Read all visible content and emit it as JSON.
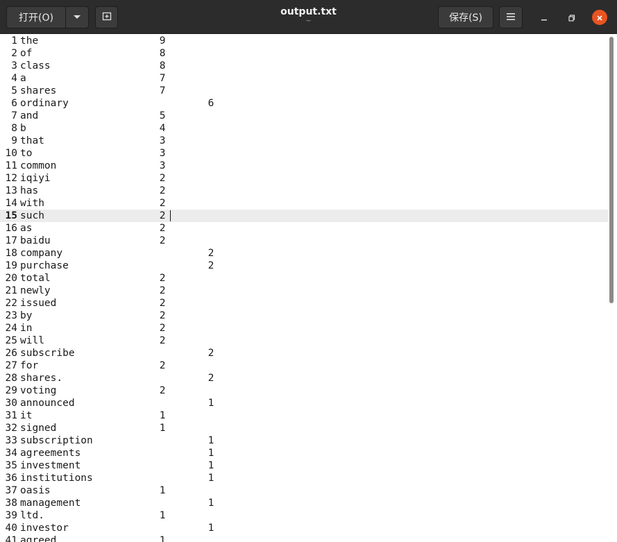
{
  "header": {
    "open_label": "打开(O)",
    "title": "output.txt",
    "subtitle": "~",
    "save_label": "保存(S)"
  },
  "icons": {
    "open_dropdown": "chevron-down-icon",
    "new_tab": "new-tab-icon",
    "menu": "hamburger-menu-icon",
    "minimize": "minimize-icon",
    "maximize": "maximize-icon",
    "close": "close-icon"
  },
  "colors": {
    "titlebar": "#2c2c2c",
    "close_button": "#e95420",
    "current_line": "#ececec"
  },
  "editor": {
    "current_line": 15,
    "lines": [
      "the                    9",
      "of                     8",
      "class                  8",
      "a                      7",
      "shares                 7",
      "ordinary                       6",
      "and                    5",
      "b                      4",
      "that                   3",
      "to                     3",
      "common                 3",
      "iqiyi                  2",
      "has                    2",
      "with                   2",
      "such                   2",
      "as                     2",
      "baidu                  2",
      "company                        2",
      "purchase                       2",
      "total                  2",
      "newly                  2",
      "issued                 2",
      "by                     2",
      "in                     2",
      "will                   2",
      "subscribe                      2",
      "for                    2",
      "shares.                        2",
      "voting                 2",
      "announced                      1",
      "it                     1",
      "signed                 1",
      "subscription                   1",
      "agreements                     1",
      "investment                     1",
      "institutions                   1",
      "oasis                  1",
      "management                     1",
      "ltd.                   1",
      "investor                       1",
      "agreed                 1"
    ]
  }
}
